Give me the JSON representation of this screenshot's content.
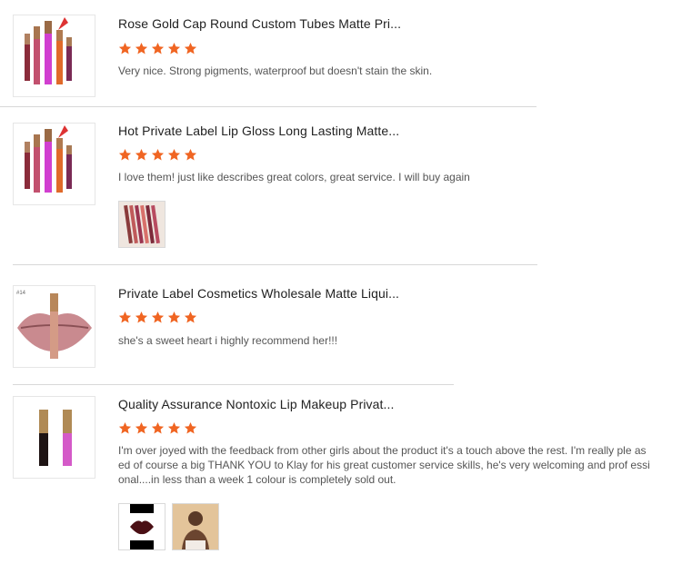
{
  "reviews": [
    {
      "title": "Rose Gold Cap Round Custom Tubes Matte Pri...",
      "text": "Very nice. Strong pigments, waterproof but doesn't stain the skin.",
      "rating": 5
    },
    {
      "title": "Hot Private Label Lip Gloss Long Lasting Matte...",
      "text": "I love them! just like describes great colors, great service. I will buy again",
      "rating": 5
    },
    {
      "title": "Private Label Cosmetics Wholesale Matte Liqui...",
      "text": "she's a sweet heart i highly recommend her!!!",
      "rating": 5,
      "thumb_tag": "#14"
    },
    {
      "title": "Quality Assurance Nontoxic Lip Makeup Privat...",
      "text": "I'm over joyed with the feedback from other girls about the product it's a touch above the rest. I'm really ple ased of course a big THANK YOU to Klay for his great customer service skills, he's very welcoming and prof essional....in less than a week 1 colour is completely sold out.",
      "rating": 5
    }
  ],
  "colors": {
    "star": "#f06522",
    "divider": "#d8d8d8"
  }
}
